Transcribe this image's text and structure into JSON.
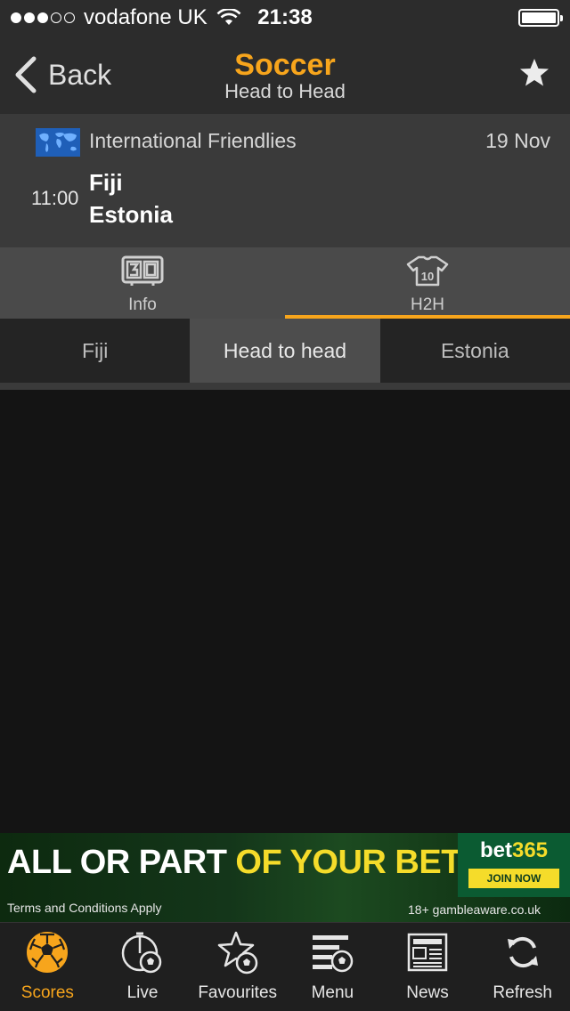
{
  "status": {
    "carrier": "vodafone UK",
    "time": "21:38",
    "signal_bars": 3,
    "signal_total": 5
  },
  "nav": {
    "back_label": "Back",
    "title": "Soccer",
    "subtitle": "Head to Head"
  },
  "match": {
    "competition": "International Friendlies",
    "date": "19 Nov",
    "kickoff": "11:00",
    "home_team": "Fiji",
    "away_team": "Estonia"
  },
  "tabs": [
    {
      "label": "Info",
      "icon": "scoreboard-icon"
    },
    {
      "label": "H2H",
      "icon": "shirt-icon"
    }
  ],
  "active_tab": "H2H",
  "segment": {
    "left": "Fiji",
    "middle": "Head to head",
    "right": "Estonia",
    "active": "Head to head"
  },
  "ad": {
    "headline_white": "ALL OR PART",
    "headline_yellow": "OF YOUR BET",
    "terms": "Terms and Conditions Apply",
    "gamble": "18+ gambleaware.co.uk",
    "brand_main": "bet",
    "brand_num": "365",
    "cta": "JOIN NOW"
  },
  "bottom_nav": [
    {
      "label": "Scores",
      "icon": "soccer-ball-icon"
    },
    {
      "label": "Live",
      "icon": "live-icon"
    },
    {
      "label": "Favourites",
      "icon": "favourites-icon"
    },
    {
      "label": "Menu",
      "icon": "menu-icon"
    },
    {
      "label": "News",
      "icon": "news-icon"
    },
    {
      "label": "Refresh",
      "icon": "refresh-icon"
    }
  ],
  "active_bottom": "Scores",
  "colors": {
    "accent": "#f7a51c",
    "navbar": "#2c2c2c",
    "match_bg": "#3a3a3a",
    "tabs_bg": "#4a4a4a",
    "content_bg": "#141414"
  }
}
